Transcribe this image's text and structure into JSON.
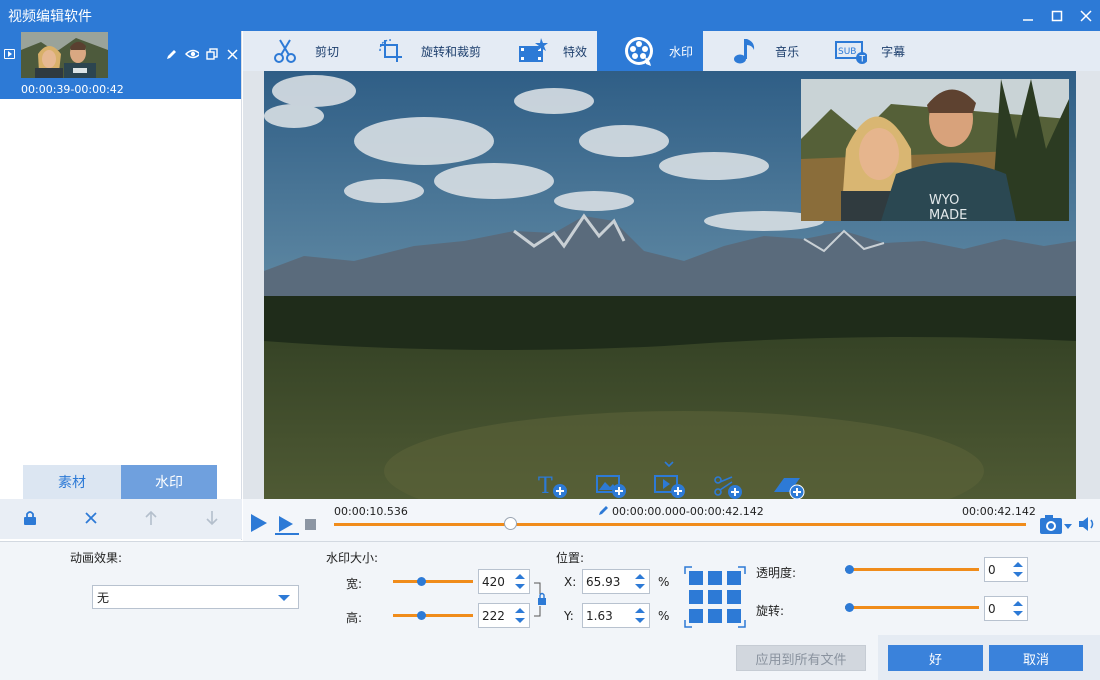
{
  "app": {
    "title": "视频编辑软件"
  },
  "clip": {
    "time_range": "00:00:39-00:00:42"
  },
  "left_tabs": {
    "material": "素材",
    "watermark": "水印"
  },
  "tabs": [
    {
      "label": "剪切",
      "icon": "scissors-icon"
    },
    {
      "label": "旋转和裁剪",
      "icon": "crop-rotate-icon"
    },
    {
      "label": "特效",
      "icon": "effects-icon"
    },
    {
      "label": "水印",
      "icon": "watermark-icon",
      "active": true
    },
    {
      "label": "音乐",
      "icon": "music-note-icon"
    },
    {
      "label": "字幕",
      "icon": "subtitle-icon"
    }
  ],
  "timeline": {
    "current": "00:00:10.536",
    "range": "00:00:00.000-00:00:42.142",
    "total": "00:00:42.142",
    "progress": 0.25
  },
  "animation": {
    "label": "动画效果:",
    "value": "无"
  },
  "wm_size": {
    "label": "水印大小:",
    "width_label": "宽:",
    "width": "420",
    "height_label": "高:",
    "height": "222"
  },
  "position": {
    "label": "位置:",
    "x_label": "X:",
    "x": "65.93",
    "y_label": "Y:",
    "y": "1.63",
    "percent": "%"
  },
  "opacity": {
    "label": "透明度:",
    "value": "0"
  },
  "rotation": {
    "label": "旋转:",
    "value": "0"
  },
  "buttons": {
    "apply_all": "应用到所有文件",
    "ok": "好",
    "cancel": "取消"
  },
  "colors": {
    "accent": "#2d7ad6",
    "slider": "#f08c1b"
  }
}
